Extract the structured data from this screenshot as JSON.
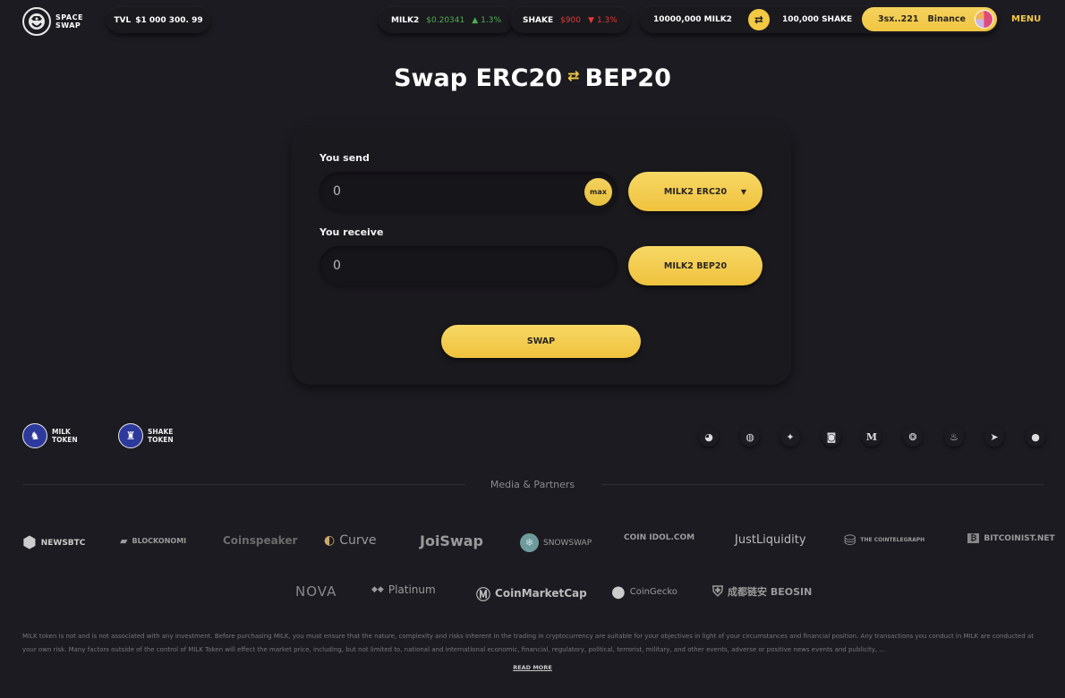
{
  "header": {
    "logo_line1": "SPACE",
    "logo_line2": "SWAP",
    "tvl_label": "TVL",
    "tvl_value": "$1 000 300. 99",
    "tickers": [
      {
        "symbol": "MILK2",
        "price": "$0.20341",
        "direction": "up",
        "arrow": "▲",
        "change": "1.3%"
      },
      {
        "symbol": "SHAKE",
        "price": "$900",
        "direction": "down",
        "arrow": "▼",
        "change": "1.3%"
      }
    ],
    "balance_milk2": "10000,000 MILK2",
    "balance_shake": "100,000 SHAKE",
    "swap_icon": "⇄",
    "wallet_address": "3sx..221",
    "wallet_network": "Binance",
    "menu_label": "MENU"
  },
  "page": {
    "title_left": "Swap ERC20",
    "title_arrows": "⇄",
    "title_right": "BEP20"
  },
  "swap_form": {
    "send_label": "You send",
    "send_value": "0",
    "max_label": "max",
    "send_token": "MILK2 ERC20",
    "send_token_caret": "▼",
    "receive_label": "You receive",
    "receive_value": "0",
    "receive_token": "MILK2 BEP20",
    "swap_button": "SWAP"
  },
  "footer": {
    "tokens": [
      {
        "line1": "MILK",
        "line2": "TOKEN"
      },
      {
        "line1": "SHAKE",
        "line2": "TOKEN"
      }
    ],
    "socials": [
      {
        "name": "coinmarketcap",
        "glyph": "◕"
      },
      {
        "name": "github",
        "glyph": "◍"
      },
      {
        "name": "twitter",
        "glyph": "✦"
      },
      {
        "name": "discord",
        "glyph": "◙"
      },
      {
        "name": "medium",
        "glyph": "M"
      },
      {
        "name": "wechat",
        "glyph": "❂"
      },
      {
        "name": "fire",
        "glyph": "♨"
      },
      {
        "name": "telegram",
        "glyph": "➤"
      },
      {
        "name": "chat",
        "glyph": "●"
      }
    ],
    "media_title": "Media & Partners",
    "partners_row1": [
      {
        "name": "NEWSBTC",
        "icon": "⬢"
      },
      {
        "name": "BLOCKONOMI",
        "icon": "▰"
      },
      {
        "name": "Coinspeaker",
        "icon": ""
      },
      {
        "name": "Curve",
        "icon": "◐"
      },
      {
        "name": "JoiSwap",
        "icon": ""
      },
      {
        "name": "SNOWSWAP",
        "icon": "❄"
      },
      {
        "name": "COIN IDOL.COM",
        "icon": ""
      },
      {
        "name": "JustLiquidity",
        "icon": ""
      },
      {
        "name": "THE COINTELEGRAPH",
        "icon": "⛁"
      },
      {
        "name": "BITCOINIST.NET",
        "icon": "₿"
      }
    ],
    "partners_row2": [
      {
        "name": "NOVA",
        "icon": ""
      },
      {
        "name": "Platinum",
        "icon": "◆◆"
      },
      {
        "name": "CoinMarketCap",
        "icon": "Ⓜ"
      },
      {
        "name": "CoinGecko",
        "icon": "●"
      },
      {
        "name": "成都链安 BEOSIN",
        "icon": "⛨"
      }
    ],
    "disclaimer": "MILK token is not and is not associated with any investment. Before purchasing MILK, you must ensure that the nature, complexity and risks inherent in the trading in cryptocurrency are suitable for your objectives in light of your circumstances and financial position. Any transactions you conduct in MILK are conducted at your own risk. Many factors outside of the control of MILK Token will effect the market price, including, but not limited to, national and international economic, financial, regulatory, political, terrorist, military, and other events, adverse or positive news events and publicity, ...",
    "read_more": "READ MORE"
  },
  "colors": {
    "background": "#1c1b21",
    "accent": "#f3c944",
    "up": "#4caf50",
    "down": "#e53935"
  }
}
